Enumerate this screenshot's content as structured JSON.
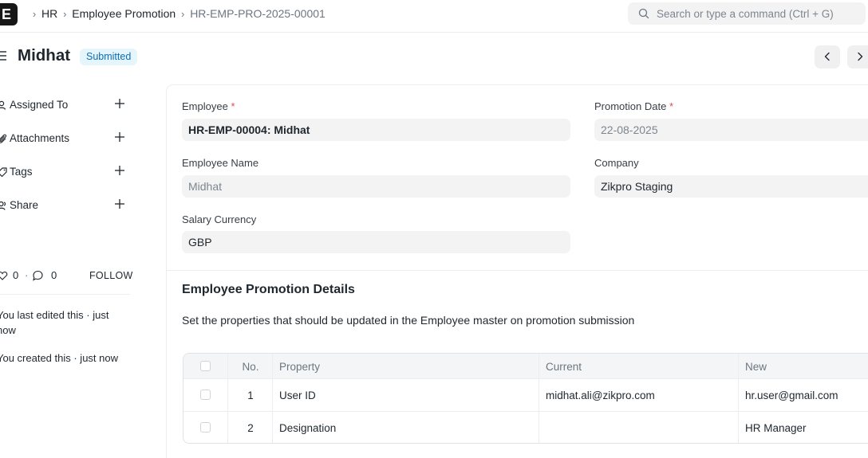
{
  "navbar": {
    "logo_letter": "E",
    "breadcrumbs": [
      "HR",
      "Employee Promotion",
      "HR-EMP-PRO-2025-00001"
    ],
    "search_placeholder": "Search or type a command (Ctrl + G)"
  },
  "page": {
    "title": "Midhat",
    "status": "Submitted"
  },
  "sidebar": {
    "items": [
      {
        "label": "Assigned To",
        "icon": "assign-icon"
      },
      {
        "label": "Attachments",
        "icon": "paperclip-icon"
      },
      {
        "label": "Tags",
        "icon": "tag-icon"
      },
      {
        "label": "Share",
        "icon": "share-icon"
      }
    ],
    "likes": "0",
    "comments": "0",
    "follow_label": "FOLLOW",
    "activity": [
      "You last edited this · just now",
      "You created this · just now"
    ]
  },
  "form": {
    "employee_label": "Employee",
    "employee_value": "HR-EMP-00004: Midhat",
    "promotion_date_label": "Promotion Date",
    "promotion_date_value": "22-08-2025",
    "employee_name_label": "Employee Name",
    "employee_name_value": "Midhat",
    "company_label": "Company",
    "company_value": "Zikpro Staging",
    "salary_currency_label": "Salary Currency",
    "salary_currency_value": "GBP",
    "required_mark": "*"
  },
  "details": {
    "title": "Employee Promotion Details",
    "description": "Set the properties that should be updated in the Employee master on promotion submission",
    "columns": [
      "No.",
      "Property",
      "Current",
      "New"
    ],
    "rows": [
      {
        "no": "1",
        "property": "User ID",
        "current": "midhat.ali@zikpro.com",
        "new": "hr.user@gmail.com"
      },
      {
        "no": "2",
        "property": "Designation",
        "current": "",
        "new": "HR Manager"
      }
    ]
  },
  "colors": {
    "badge_bg": "#e6f4fc",
    "badge_text": "#0a6fb4",
    "required": "#e24c4c"
  }
}
